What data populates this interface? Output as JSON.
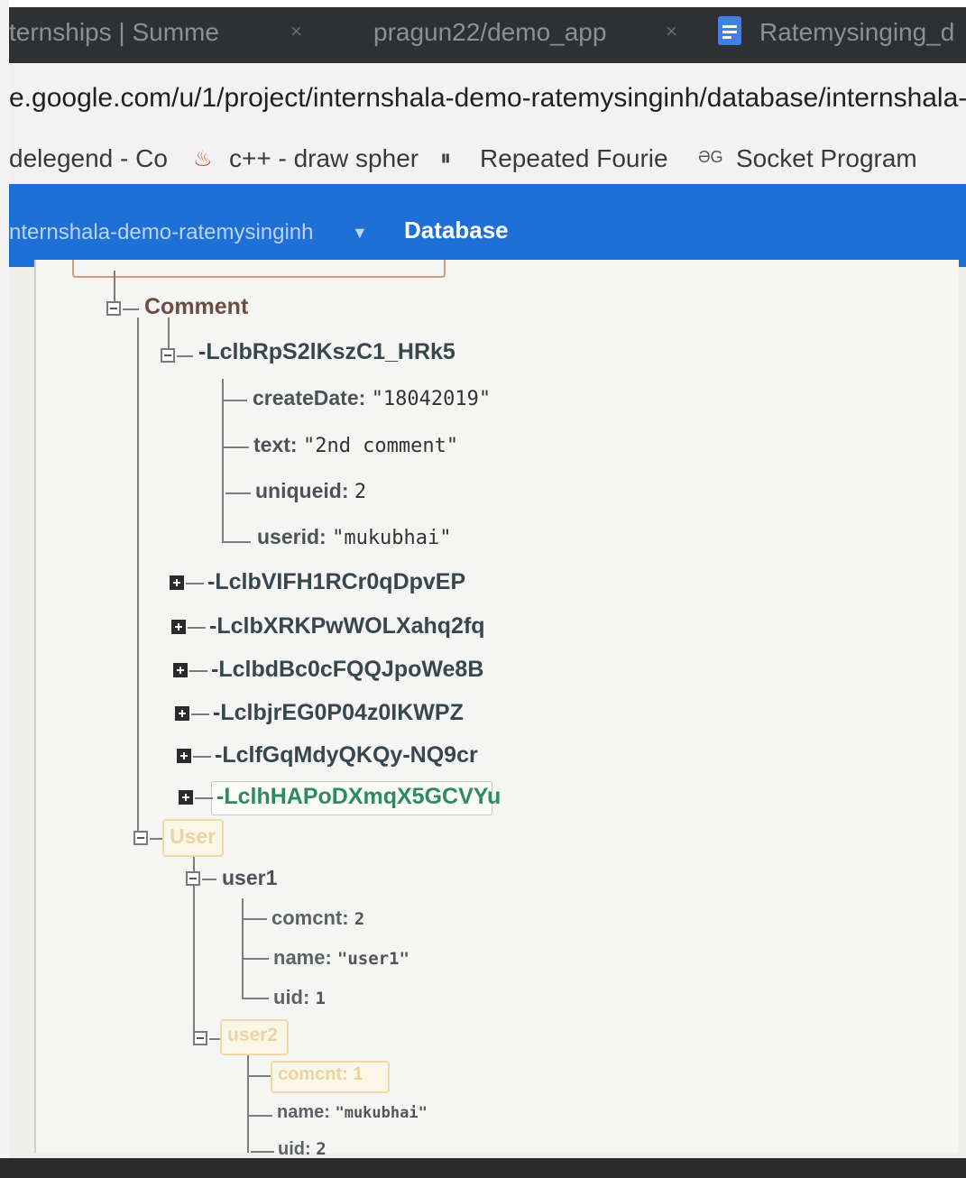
{
  "browser": {
    "tabs": [
      {
        "title": "ternships | Summe"
      },
      {
        "title": "pragun22/demo_app"
      },
      {
        "title": "Ratemysinging_d"
      }
    ],
    "tab_close_glyph": "×",
    "active_tab_icon": "document-icon",
    "url": "e.google.com/u/1/project/internshala-demo-ratemysinginh/database/internshala-demo-rate",
    "bookmarks": [
      {
        "label": "delegend - Co",
        "icon": ""
      },
      {
        "label": "c++ - draw spher",
        "icon": "java-cup-icon"
      },
      {
        "label": "Repeated Fourie",
        "icon": "pause-circle-icon"
      },
      {
        "label": "Socket Program",
        "icon": "geeks-logo-icon",
        "icon_text": "ƏG"
      }
    ]
  },
  "firebase": {
    "project_name": "nternshala-demo-ratemysinginh",
    "section": "Database",
    "header_color": "#1e6fd6"
  },
  "tree": {
    "comment": {
      "key": "Comment",
      "expanded_entry": {
        "key": "-LclbRpS2lKszC1_HRk5",
        "fields": [
          {
            "key": "createDate:",
            "value": "\"18042019\""
          },
          {
            "key": "text:",
            "value": "\"2nd comment\""
          },
          {
            "key": "uniqueid:",
            "value": "2"
          },
          {
            "key": "userid:",
            "value": "\"mukubhai\""
          }
        ]
      },
      "collapsed_entries": [
        {
          "key": "-LclbVIFH1RCr0qDpvEP"
        },
        {
          "key": "-LclbXRKPwWOLXahq2fq"
        },
        {
          "key": "-LclbdBc0cFQQJpoWe8B"
        },
        {
          "key": "-LclbjrEG0P04z0IKWPZ"
        },
        {
          "key": "-LclfGqMdyQKQy-NQ9cr"
        },
        {
          "key": "-LclhHAPoDXmqX5GCVYu"
        }
      ]
    },
    "user": {
      "key": "User",
      "user1": {
        "key": "user1",
        "fields": [
          {
            "key": "comcnt:",
            "value": "2"
          },
          {
            "key": "name:",
            "value": "\"user1\""
          },
          {
            "key": "uid:",
            "value": "1"
          }
        ]
      },
      "user2": {
        "key": "user2",
        "fields": [
          {
            "key": "comcnt:",
            "value": "1"
          },
          {
            "key": "name:",
            "value": "\"mukubhai\""
          },
          {
            "key": "uid:",
            "value": "2"
          }
        ]
      }
    }
  }
}
